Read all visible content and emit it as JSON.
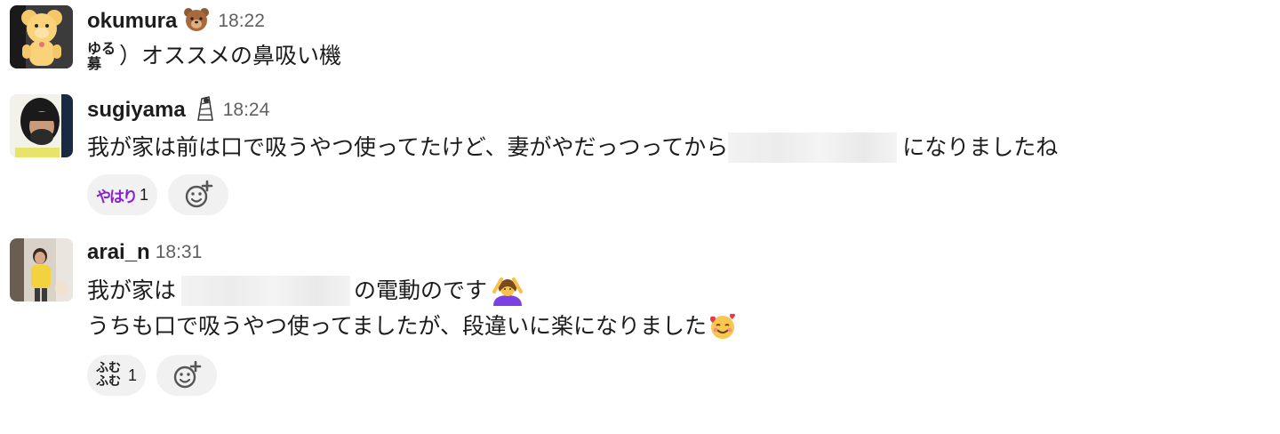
{
  "messages": [
    {
      "author": "okumura",
      "status_emoji": "bear-face-emoji",
      "time": "18:22",
      "emoji_text_top": "ゆる",
      "emoji_text_bottom": "募",
      "text": "）オススメの鼻吸い機"
    },
    {
      "author": "sugiyama",
      "status_emoji": "character-emoji",
      "time": "18:24",
      "text_before": "我が家は前は口で吸うやつ使ってたけど、妻がやだっつってから",
      "text_after": "になりましたね",
      "reaction": {
        "emoji_text": "やはり",
        "count": "1",
        "color": "#8a1fd6"
      }
    },
    {
      "author": "arai_n",
      "time": "18:31",
      "line1_before": "我が家は",
      "line1_after": "の電動のです",
      "line2": "うちも口で吸うやつ使ってましたが、段違いに楽になりました",
      "reaction": {
        "emoji_text": "ふむふむ",
        "count": "1"
      }
    }
  ],
  "icons": [
    "add-reaction-icon",
    "woman-gesturing-ok-emoji",
    "smiling-face-with-hearts-emoji"
  ]
}
